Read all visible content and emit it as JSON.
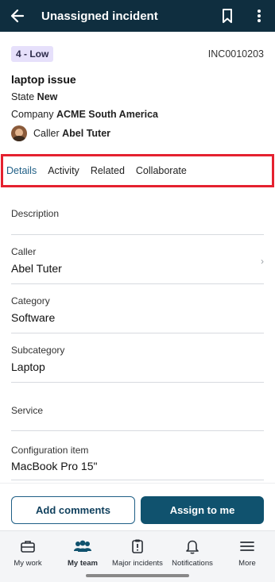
{
  "appbar": {
    "title": "Unassigned incident"
  },
  "incident": {
    "priority": "4 - Low",
    "number": "INC0010203",
    "title": "laptop issue",
    "state_label": "State",
    "state_value": "New",
    "company_label": "Company",
    "company_value": "ACME South America",
    "caller_label": "Caller",
    "caller_value": "Abel Tuter"
  },
  "tabs": [
    {
      "label": "Details",
      "active": true
    },
    {
      "label": "Activity"
    },
    {
      "label": "Related"
    },
    {
      "label": "Collaborate"
    }
  ],
  "fields": [
    {
      "label": "Description",
      "value": ""
    },
    {
      "label": "Caller",
      "value": "Abel Tuter"
    },
    {
      "label": "Category",
      "value": "Software"
    },
    {
      "label": "Subcategory",
      "value": "Laptop"
    },
    {
      "label": "Service",
      "value": ""
    },
    {
      "label": "Configuration item",
      "value": "MacBook Pro 15\""
    }
  ],
  "actions": {
    "add_comments": "Add comments",
    "assign_to_me": "Assign to me"
  },
  "bottom_nav": [
    {
      "label": "My work",
      "icon": "briefcase-icon"
    },
    {
      "label": "My team",
      "icon": "team-icon",
      "active": true
    },
    {
      "label": "Major incidents",
      "icon": "clipboard-alert-icon"
    },
    {
      "label": "Notifications",
      "icon": "bell-icon"
    },
    {
      "label": "More",
      "icon": "menu-icon"
    }
  ],
  "colors": {
    "header_bg": "#0f2e3f",
    "accent": "#10526e",
    "highlight": "#e5212f",
    "priority_badge_bg": "#e6e0fb"
  }
}
